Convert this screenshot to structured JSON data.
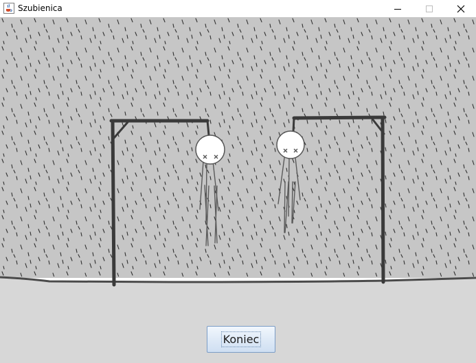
{
  "window": {
    "title": "Szubienica",
    "icons": {
      "app": "java-cup-icon",
      "minimize": "minimize-icon",
      "maximize": "maximize-icon",
      "close": "close-icon"
    }
  },
  "game": {
    "end_button_label": "Koniec",
    "colors": {
      "wall": "#c6c6c6",
      "floor": "#d7d7d7",
      "ink": "#3a3a3a",
      "head": "#ffffff",
      "button_border": "#7a9cc6"
    }
  }
}
